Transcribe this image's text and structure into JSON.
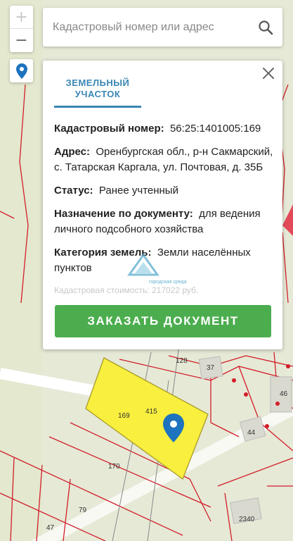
{
  "zoom": {
    "in_label": "+",
    "out_label": "−"
  },
  "search": {
    "placeholder": "Кадастровый номер или адрес",
    "value": ""
  },
  "popup": {
    "tab_label": "ЗЕМЕЛЬНЫЙ УЧАСТОК",
    "cadastral_label": "Кадастровый номер:",
    "cadastral_value": "56:25:1401005:169",
    "address_label": "Адрес:",
    "address_value": "Оренбургская обл., р-н Сакмарский, с. Татарская Каргала, ул. Почтовая, д. 35Б",
    "status_label": "Статус:",
    "status_value": "Ранее учтенный",
    "purpose_label": "Назначение по документу:",
    "purpose_value": "для ведения личного подсобного хозяйства",
    "category_label": "Категория земель:",
    "category_value": "Земли населённых пунктов",
    "cost_partial": "Кадастровая стоимость: 217022 руб.",
    "order_button": "ЗАКАЗАТЬ ДОКУМЕНТ"
  },
  "watermark": {
    "text": "городская среда"
  },
  "map_labels": {
    "l128": "128",
    "l37": "37",
    "l46": "46",
    "l44": "44",
    "l169": "169",
    "l415": "415",
    "l170": "170",
    "l79": "79",
    "l47": "47",
    "l2340": "2340"
  },
  "colors": {
    "accent": "#3a86b4",
    "order_button": "#4cad4e",
    "parcel_fill": "#f8ef3e",
    "parcel_line": "#d31d2a"
  }
}
